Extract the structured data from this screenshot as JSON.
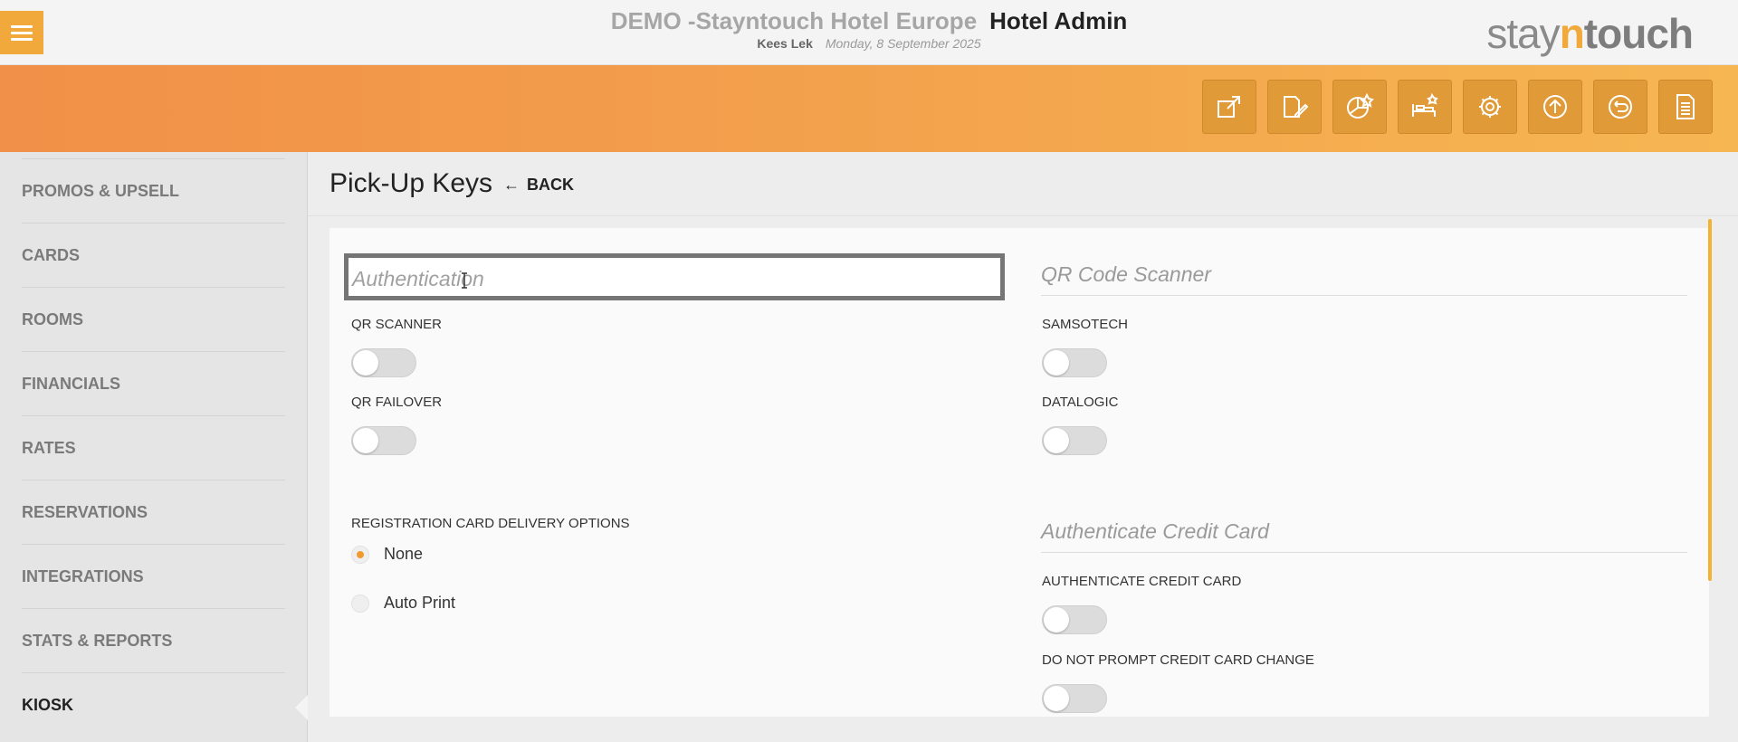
{
  "header": {
    "hotel_name": "DEMO -Stayntouch Hotel Europe",
    "app_name": "Hotel Admin",
    "user": "Kees Lek",
    "date": "Monday, 8 September 2025",
    "logo": {
      "part1": "stay",
      "part2": "n",
      "part3": "touch"
    }
  },
  "toolbar_icons": [
    "open-external-icon",
    "edit-document-icon",
    "chart-star-icon",
    "bed-star-icon",
    "settings-gear-icon",
    "upload-icon",
    "user-return-icon",
    "document-list-icon"
  ],
  "sidebar": {
    "items": [
      {
        "label": "PROMOS & UPSELL"
      },
      {
        "label": "CARDS"
      },
      {
        "label": "ROOMS"
      },
      {
        "label": "FINANCIALS"
      },
      {
        "label": "RATES"
      },
      {
        "label": "RESERVATIONS"
      },
      {
        "label": "INTEGRATIONS"
      },
      {
        "label": "STATS & REPORTS"
      },
      {
        "label": "KIOSK"
      }
    ]
  },
  "page": {
    "title": "Pick-Up Keys",
    "back_label": "BACK"
  },
  "left": {
    "auth_placeholder": "Authentication",
    "qr_scanner": {
      "label": "QR SCANNER",
      "on": false
    },
    "qr_failover": {
      "label": "QR FAILOVER",
      "on": false
    },
    "reg_card_label": "REGISTRATION CARD DELIVERY OPTIONS",
    "options": [
      {
        "label": "None",
        "selected": true
      },
      {
        "label": "Auto Print",
        "selected": false
      }
    ]
  },
  "right": {
    "qr_section_title": "QR Code Scanner",
    "samsotech": {
      "label": "SAMSOTECH",
      "on": false
    },
    "datalogic": {
      "label": "DATALOGIC",
      "on": false
    },
    "cc_section_title": "Authenticate Credit Card",
    "auth_cc": {
      "label": "AUTHENTICATE CREDIT CARD",
      "on": false
    },
    "no_prompt_cc": {
      "label": "DO NOT PROMPT CREDIT CARD CHANGE",
      "on": false
    }
  },
  "colors": {
    "accent": "#f2a93b",
    "band_start": "#f19048",
    "band_end": "#f6b652"
  }
}
